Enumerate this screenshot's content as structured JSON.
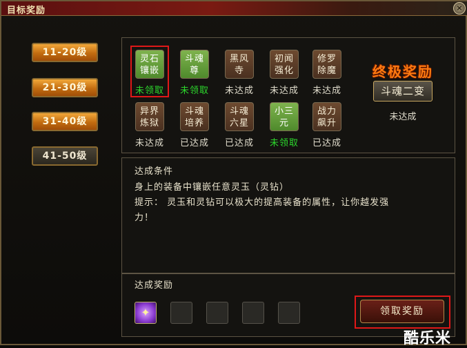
{
  "window": {
    "title": "目标奖励",
    "close_label": "×"
  },
  "levels": [
    {
      "label": "11-20级",
      "active": true
    },
    {
      "label": "21-30级",
      "active": true
    },
    {
      "label": "31-40级",
      "active": true
    },
    {
      "label": "41-50级",
      "active": false
    }
  ],
  "tasks_row1": [
    {
      "name": "灵石镶嵌",
      "line1": "灵石",
      "line2": "镶嵌",
      "status": "未领取",
      "color": "green"
    },
    {
      "name": "斗魂尊",
      "line1": "斗魂",
      "line2": "尊",
      "status": "未领取",
      "color": "green"
    },
    {
      "name": "黑风寺",
      "line1": "黑风",
      "line2": "寺",
      "status": "未达成",
      "color": "brown"
    },
    {
      "name": "初闻强化",
      "line1": "初闻",
      "line2": "强化",
      "status": "未达成",
      "color": "brown"
    },
    {
      "name": "修罗除魔",
      "line1": "修罗",
      "line2": "除魔",
      "status": "未达成",
      "color": "brown"
    }
  ],
  "tasks_row2": [
    {
      "name": "异界炼狱",
      "line1": "异界",
      "line2": "炼狱",
      "status": "未达成",
      "color": "brown"
    },
    {
      "name": "斗魂培养",
      "line1": "斗魂",
      "line2": "培养",
      "status": "已达成",
      "color": "brown"
    },
    {
      "name": "斗魂六星",
      "line1": "斗魂",
      "line2": "六星",
      "status": "已达成",
      "color": "brown"
    },
    {
      "name": "小三元",
      "line1": "小三",
      "line2": "元",
      "status": "未领取",
      "color": "green"
    },
    {
      "name": "战力飙升",
      "line1": "战力",
      "line2": "飙升",
      "status": "已达成",
      "color": "brown"
    }
  ],
  "final_reward": {
    "title": "终极奖励",
    "name": "斗魂二变",
    "status": "未达成"
  },
  "conditions": {
    "title": "达成条件",
    "line1": "身上的装备中镶嵌任意灵玉（灵钻）",
    "line2": "提示： 灵玉和灵钻可以极大的提高装备的属性，让你越发强",
    "line3": "力！"
  },
  "rewards": {
    "title": "达成奖励",
    "claim_label": "领取奖励"
  },
  "watermark": "酷乐米",
  "colors": {
    "status_done": "#2cd82c",
    "highlight": "#e01818",
    "final_title": "#ff7a10"
  }
}
